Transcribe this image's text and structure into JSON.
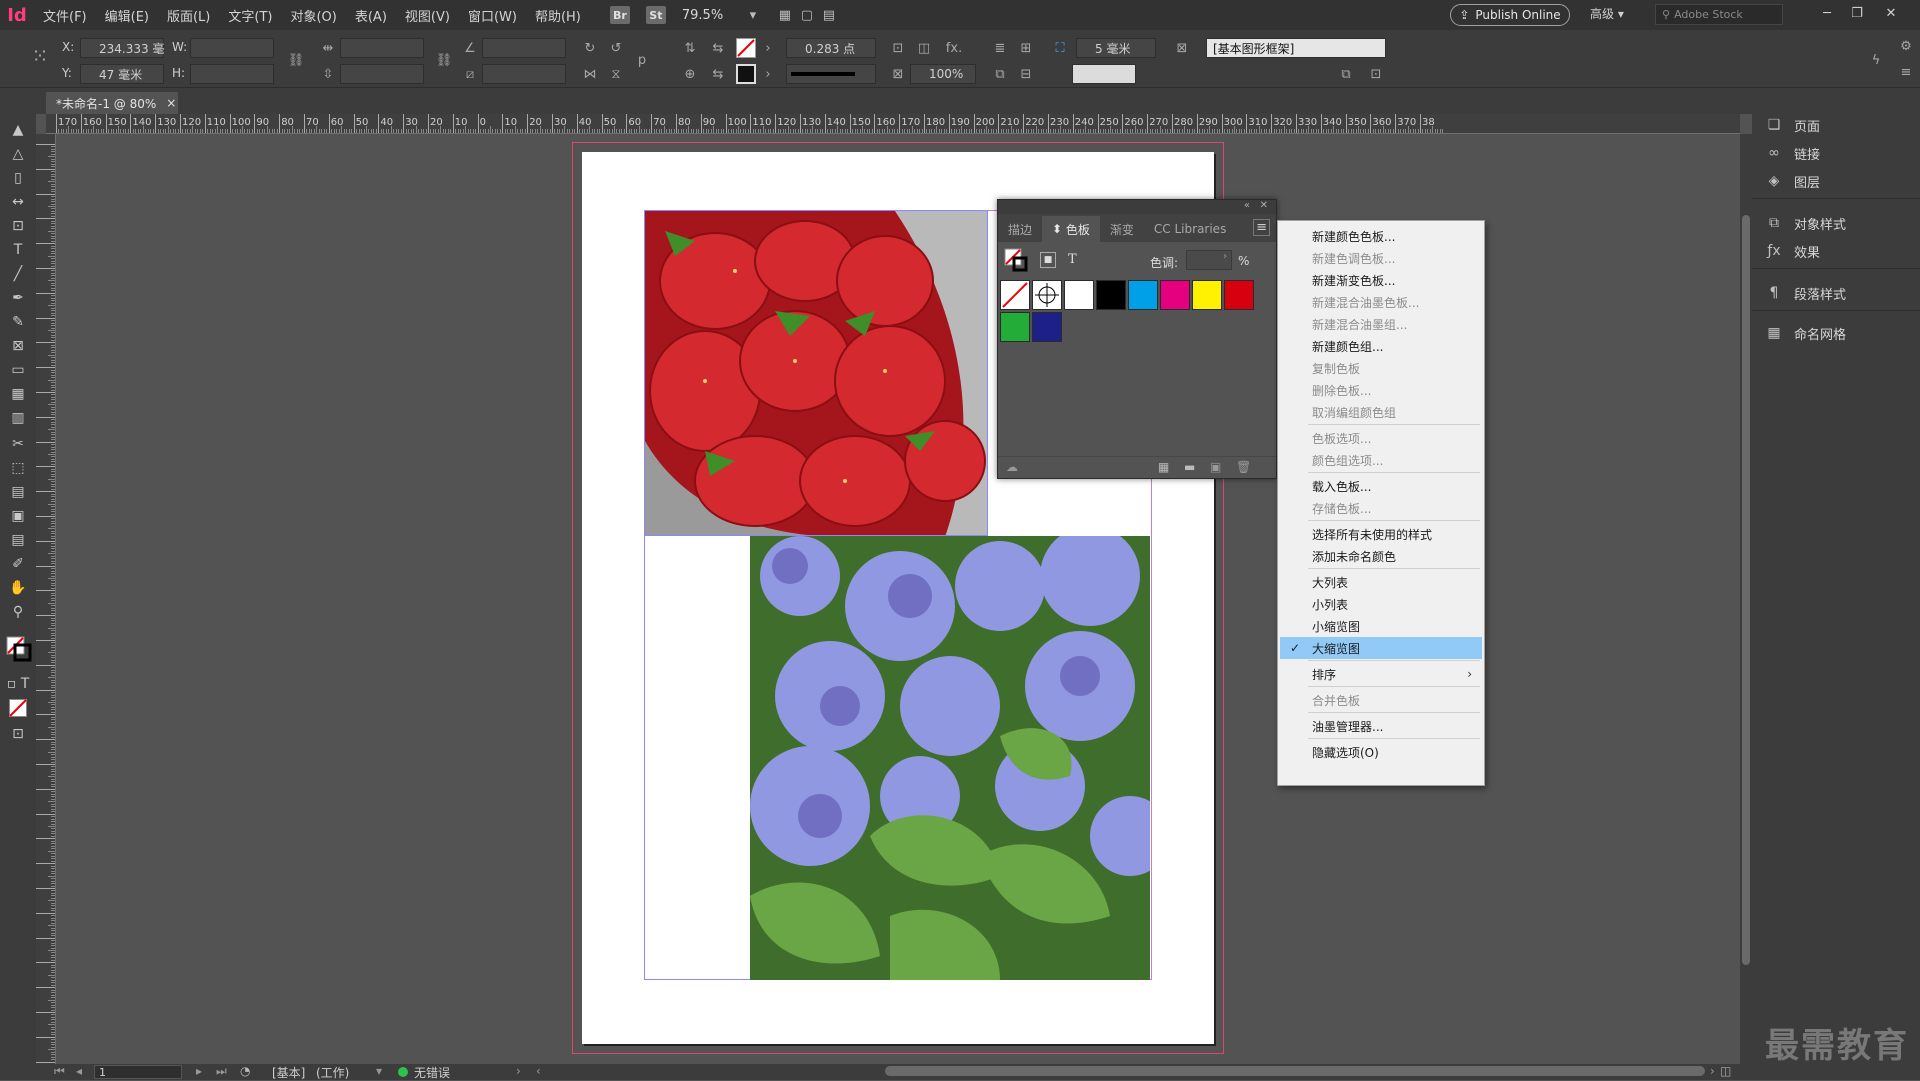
{
  "app": {
    "logo": "Id"
  },
  "menu": [
    "文件(F)",
    "编辑(E)",
    "版面(L)",
    "文字(T)",
    "对象(O)",
    "表(A)",
    "视图(V)",
    "窗口(W)",
    "帮助(H)"
  ],
  "app_badges": [
    "Br",
    "St"
  ],
  "zoom": "79.5%",
  "publish_label": "Publish Online",
  "workspace": "高级",
  "stock_placeholder": "Adobe Stock",
  "control": {
    "x_label": "X:",
    "x_value": "234.333 毫",
    "y_label": "Y:",
    "y_value": "47 毫米",
    "w_label": "W:",
    "h_label": "H:",
    "stroke_weight": "0.283 点",
    "scale": "100%",
    "gap": "5 毫米",
    "style": "[基本图形框架]"
  },
  "doc_tab": {
    "title": "*未命名-1 @ 80%",
    "close": "×"
  },
  "ruler_h": [
    "170",
    "160",
    "150",
    "140",
    "130",
    "120",
    "110",
    "100",
    "90",
    "80",
    "70",
    "60",
    "50",
    "40",
    "30",
    "20",
    "10",
    "0",
    "10",
    "20",
    "30",
    "40",
    "50",
    "60",
    "70",
    "80",
    "90",
    "100",
    "110",
    "120",
    "130",
    "140",
    "150",
    "160",
    "170",
    "180",
    "190",
    "200",
    "210",
    "220",
    "230",
    "240",
    "250",
    "260",
    "270",
    "280",
    "290",
    "300",
    "310",
    "320",
    "330",
    "340",
    "350",
    "360",
    "370",
    "38"
  ],
  "swatches_panel": {
    "tabs": [
      "描边",
      "色板",
      "渐变",
      "CC Libraries"
    ],
    "active_tab": "色板",
    "tint_label": "色调:",
    "tint_unit": "%",
    "text_mode": "T",
    "colors": [
      "#ffffff",
      "#000000",
      "#00a0e9",
      "#e4007f",
      "#fff100",
      "#d7000f",
      "#22ac38",
      "#1d2088"
    ]
  },
  "context_menu": {
    "items": [
      {
        "label": "新建颜色色板...",
        "disabled": false
      },
      {
        "label": "新建色调色板...",
        "disabled": true
      },
      {
        "label": "新建渐变色板...",
        "disabled": false
      },
      {
        "label": "新建混合油墨色板...",
        "disabled": true
      },
      {
        "label": "新建混合油墨组...",
        "disabled": true
      },
      {
        "label": "新建颜色组...",
        "disabled": false
      },
      {
        "label": "复制色板",
        "disabled": true
      },
      {
        "label": "删除色板...",
        "disabled": true
      },
      {
        "label": "取消编组颜色组",
        "disabled": true
      },
      {
        "label": "色板选项...",
        "disabled": true
      },
      {
        "label": "颜色组选项...",
        "disabled": true
      },
      {
        "label": "载入色板...",
        "disabled": false
      },
      {
        "label": "存储色板...",
        "disabled": true
      },
      {
        "label": "选择所有未使用的样式",
        "disabled": false
      },
      {
        "label": "添加未命名颜色",
        "disabled": false
      },
      {
        "label": "大列表",
        "disabled": false
      },
      {
        "label": "小列表",
        "disabled": false
      },
      {
        "label": "小缩览图",
        "disabled": false
      },
      {
        "label": "大缩览图",
        "disabled": false,
        "checked": true
      },
      {
        "label": "排序",
        "disabled": false,
        "submenu": true
      },
      {
        "label": "合并色板",
        "disabled": true
      },
      {
        "label": "油墨管理器...",
        "disabled": false
      },
      {
        "label": "隐藏选项(O)",
        "disabled": false
      }
    ],
    "check": "✓",
    "submenu_arrow": "›"
  },
  "right_panel": [
    "页面",
    "链接",
    "图层",
    "对象样式",
    "效果",
    "段落样式",
    "命名网格"
  ],
  "status": {
    "page": "1",
    "style": "[基本]",
    "state": "(工作)",
    "errors": "无错误"
  },
  "watermark": "最需教育"
}
